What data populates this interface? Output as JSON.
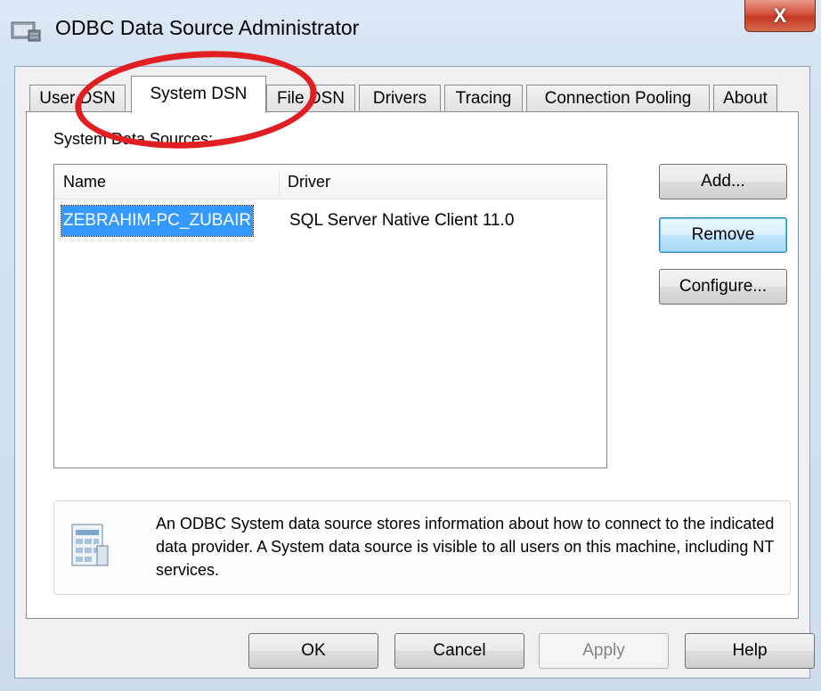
{
  "window": {
    "title": "ODBC Data Source Administrator",
    "close_label": "X"
  },
  "tabs": [
    {
      "label": "User DSN"
    },
    {
      "label": "System DSN"
    },
    {
      "label": "File DSN"
    },
    {
      "label": "Drivers"
    },
    {
      "label": "Tracing"
    },
    {
      "label": "Connection Pooling"
    },
    {
      "label": "About"
    }
  ],
  "active_tab": "System DSN",
  "section_label": "System Data Sources:",
  "list": {
    "columns": [
      "Name",
      "Driver"
    ],
    "rows": [
      {
        "name": "ZEBRAHIM-PC_ZUBAIR",
        "driver": "SQL Server Native Client 11.0",
        "selected": true
      }
    ]
  },
  "side_buttons": {
    "add": "Add...",
    "remove": "Remove",
    "configure": "Configure..."
  },
  "info": {
    "icon": "data-source-icon",
    "text": "An ODBC System data source stores information about how to connect to the indicated data provider.   A System data source is visible to all users on this machine, including NT services."
  },
  "footer_buttons": {
    "ok": "OK",
    "cancel": "Cancel",
    "apply": "Apply",
    "help": "Help"
  },
  "colors": {
    "selection": "#3399ff",
    "annotation": "#e11e22",
    "close_button": "#c43a22"
  }
}
